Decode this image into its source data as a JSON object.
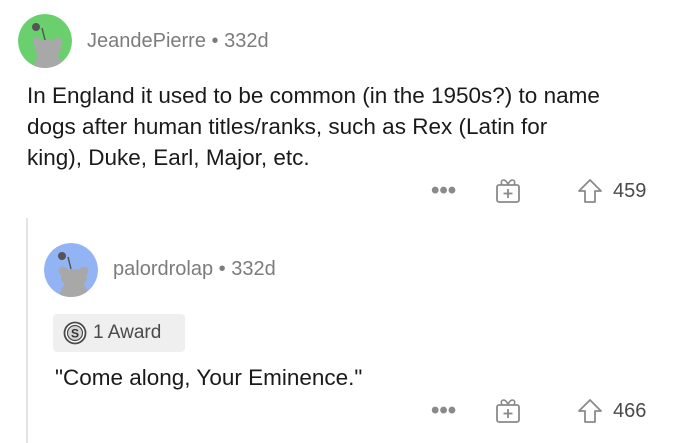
{
  "comment": {
    "username": "JeandePierre",
    "separator": "•",
    "age": "332d",
    "body_lines": [
      "In England it used to be common (in the 1950s?) to name",
      "dogs after human titles/ranks, such as Rex (Latin for",
      "king), Duke, Earl, Major, etc."
    ],
    "more_icon": "more-dots-icon",
    "award_icon": "gift-award-icon",
    "upvote_icon": "upvote-arrow-icon",
    "votes": "459",
    "avatar_color": "#6ad06e"
  },
  "reply": {
    "username": "palordrolap",
    "separator": "•",
    "age": "332d",
    "award_badge": {
      "icon": "silver-award-icon",
      "label": "1 Award"
    },
    "body": "\"Come along, Your Eminence.\"",
    "more_icon": "more-dots-icon",
    "award_icon": "gift-award-icon",
    "upvote_icon": "upvote-arrow-icon",
    "votes": "466",
    "avatar_color": "#93b4f4"
  }
}
